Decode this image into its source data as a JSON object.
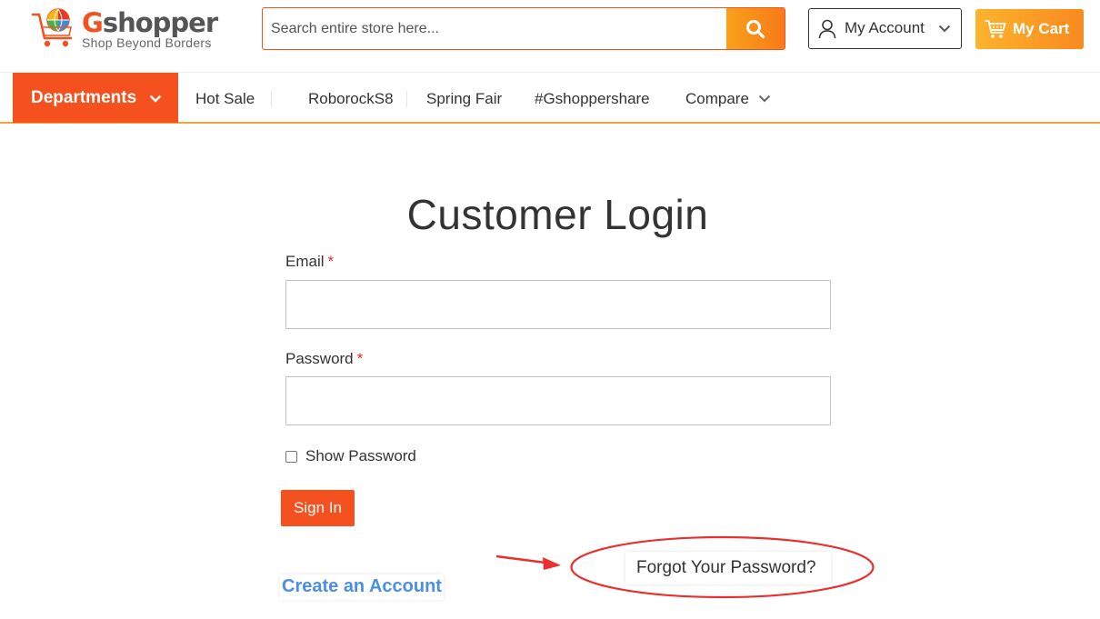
{
  "header": {
    "logo": {
      "name_first_letter": "G",
      "name_rest": "shopper",
      "tagline": "Shop Beyond Borders"
    },
    "search": {
      "placeholder": "Search entire store here..."
    },
    "account_label": "My Account",
    "cart_label": "My Cart"
  },
  "nav": {
    "departments_label": "Departments",
    "items": [
      {
        "label": "Hot Sale"
      },
      {
        "label": "RoborockS8"
      },
      {
        "label": "Spring Fair"
      },
      {
        "label": "#Gshoppershare"
      },
      {
        "label": "Compare"
      }
    ]
  },
  "login": {
    "title": "Customer Login",
    "email_label": "Email",
    "password_label": "Password",
    "required_mark": "*",
    "show_password_label": "Show Password",
    "sign_in_label": "Sign In",
    "forgot_label": "Forgot Your Password?",
    "create_account_label": "Create an Account"
  },
  "colors": {
    "brand_orange": "#f5511e",
    "cart_orange": "#f98a1f",
    "link_blue": "#4a90e2",
    "annotation_red": "#e8302f"
  }
}
